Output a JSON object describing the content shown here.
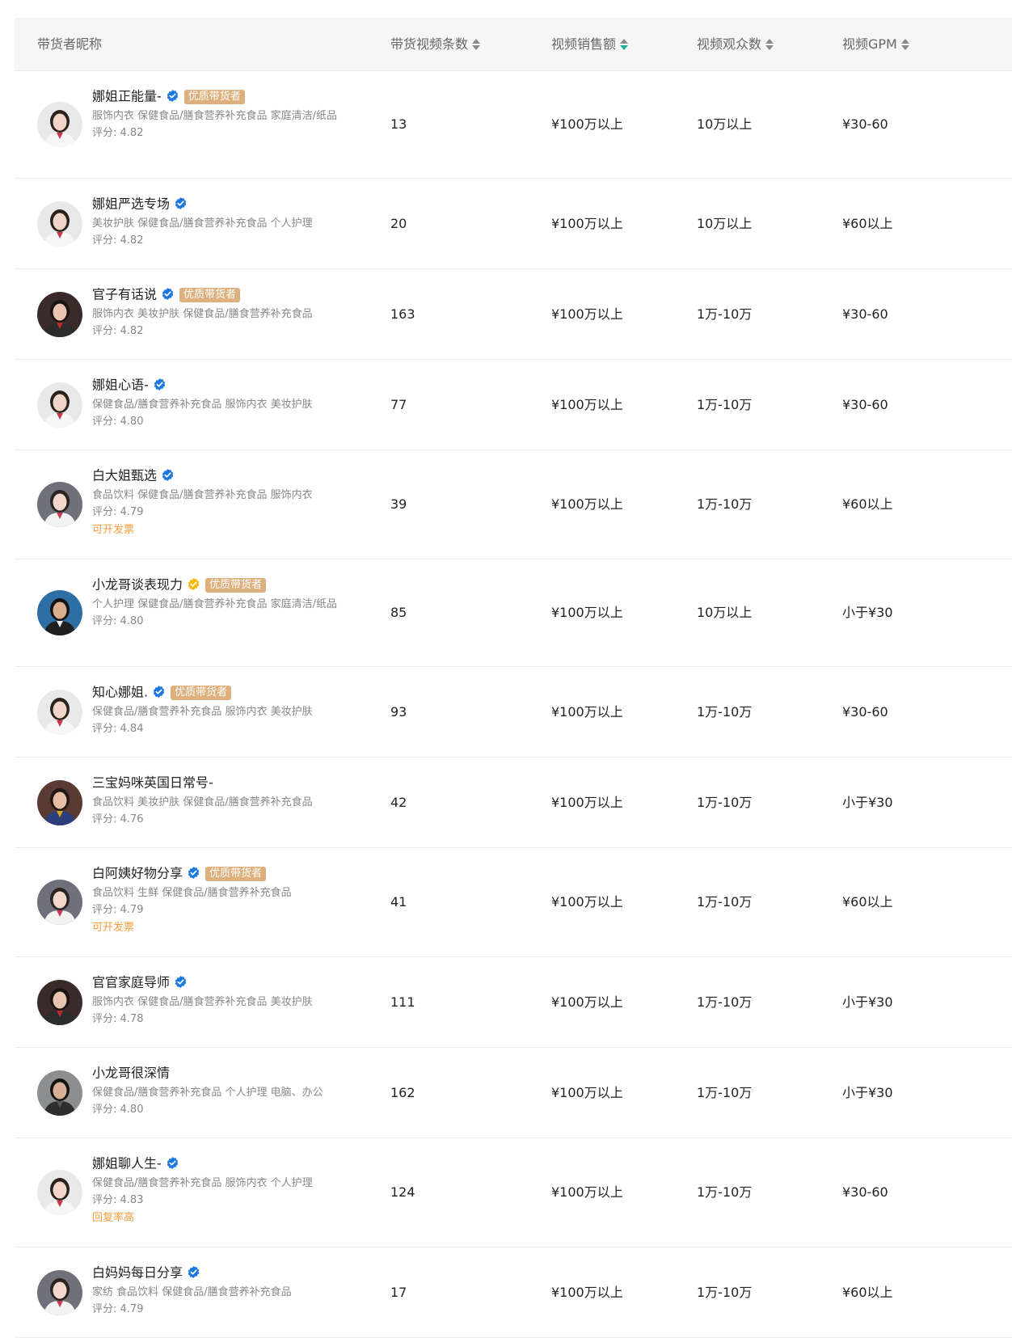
{
  "table": {
    "headers": {
      "name": "带货者昵称",
      "video_count": "带货视频条数",
      "video_sales": "视频销售额",
      "video_viewers": "视频观众数",
      "video_gpm": "视频GPM"
    },
    "active_sort": "video_sales",
    "score_prefix": "评分: ",
    "colors": {
      "badge_bg": "#ddb07e",
      "verified_blue": "#1b78e0",
      "verified_gold": "#f5b800",
      "sort_active": "#1ab394",
      "tag_orange": "#f59b3a"
    },
    "rows": [
      {
        "name": "娜姐正能量-",
        "verified": "blue",
        "badge": "优质带货者",
        "categories": "服饰内衣 保健食品/膳食营养补充食品 家庭清洁/纸品",
        "score": "4.82",
        "extra": "",
        "video_count": "13",
        "video_sales": "¥100万以上",
        "video_viewers": "10万以上",
        "video_gpm": "¥30-60",
        "avatar": "woman-white-suit"
      },
      {
        "name": "娜姐严选专场",
        "verified": "blue",
        "badge": "",
        "categories": "美妆护肤 保健食品/膳食营养补充食品 个人护理",
        "score": "4.82",
        "extra": "",
        "video_count": "20",
        "video_sales": "¥100万以上",
        "video_viewers": "10万以上",
        "video_gpm": "¥60以上",
        "avatar": "woman-white-suit"
      },
      {
        "name": "官子有话说",
        "verified": "blue",
        "badge": "优质带货者",
        "categories": "服饰内衣 美妆护肤 保健食品/膳食营养补充食品",
        "score": "4.82",
        "extra": "",
        "video_count": "163",
        "video_sales": "¥100万以上",
        "video_viewers": "1万-10万",
        "video_gpm": "¥30-60",
        "avatar": "man-dark"
      },
      {
        "name": "娜姐心语-",
        "verified": "blue",
        "badge": "",
        "categories": "保健食品/膳食营养补充食品 服饰内衣 美妆护肤",
        "score": "4.80",
        "extra": "",
        "video_count": "77",
        "video_sales": "¥100万以上",
        "video_viewers": "1万-10万",
        "video_gpm": "¥30-60",
        "avatar": "woman-white-suit"
      },
      {
        "name": "白大姐甄选",
        "verified": "blue",
        "badge": "",
        "categories": "食品饮料 保健食品/膳食营养补充食品 服饰内衣",
        "score": "4.79",
        "extra": "可开发票",
        "video_count": "39",
        "video_sales": "¥100万以上",
        "video_viewers": "1万-10万",
        "video_gpm": "¥60以上",
        "avatar": "woman-grey-bg"
      },
      {
        "name": "小龙哥谈表现力",
        "verified": "gold",
        "badge": "优质带货者",
        "categories": "个人护理 保健食品/膳食营养补充食品 家庭清洁/纸品",
        "score": "4.80",
        "extra": "",
        "video_count": "85",
        "video_sales": "¥100万以上",
        "video_viewers": "10万以上",
        "video_gpm": "小于¥30",
        "avatar": "man-blue-bg"
      },
      {
        "name": "知心娜姐.",
        "verified": "blue",
        "badge": "优质带货者",
        "categories": "保健食品/膳食营养补充食品 服饰内衣 美妆护肤",
        "score": "4.84",
        "extra": "",
        "video_count": "93",
        "video_sales": "¥100万以上",
        "video_viewers": "1万-10万",
        "video_gpm": "¥30-60",
        "avatar": "woman-white-suit"
      },
      {
        "name": "三宝妈咪英国日常号-",
        "verified": "",
        "badge": "",
        "categories": "食品饮料 美妆护肤 保健食品/膳食营养补充食品",
        "score": "4.76",
        "extra": "",
        "video_count": "42",
        "video_sales": "¥100万以上",
        "video_viewers": "1万-10万",
        "video_gpm": "小于¥30",
        "avatar": "family"
      },
      {
        "name": "白阿姨好物分享",
        "verified": "blue",
        "badge": "优质带货者",
        "categories": "食品饮料 生鲜 保健食品/膳食营养补充食品",
        "score": "4.79",
        "extra": "可开发票",
        "video_count": "41",
        "video_sales": "¥100万以上",
        "video_viewers": "1万-10万",
        "video_gpm": "¥60以上",
        "avatar": "woman-grey-bg"
      },
      {
        "name": "官官家庭导师",
        "verified": "blue",
        "badge": "",
        "categories": "服饰内衣 保健食品/膳食营养补充食品 美妆护肤",
        "score": "4.78",
        "extra": "",
        "video_count": "111",
        "video_sales": "¥100万以上",
        "video_viewers": "1万-10万",
        "video_gpm": "小于¥30",
        "avatar": "man-dark"
      },
      {
        "name": "小龙哥很深情",
        "verified": "",
        "badge": "",
        "categories": "保健食品/膳食营养补充食品 个人护理 电脑、办公",
        "score": "4.80",
        "extra": "",
        "video_count": "162",
        "video_sales": "¥100万以上",
        "video_viewers": "1万-10万",
        "video_gpm": "小于¥30",
        "avatar": "man-grey-bg"
      },
      {
        "name": "娜姐聊人生-",
        "verified": "blue",
        "badge": "",
        "categories": "保健食品/膳食营养补充食品 服饰内衣 个人护理",
        "score": "4.83",
        "extra": "回复率高",
        "video_count": "124",
        "video_sales": "¥100万以上",
        "video_viewers": "1万-10万",
        "video_gpm": "¥30-60",
        "avatar": "woman-white-suit"
      },
      {
        "name": "白妈妈每日分享",
        "verified": "blue",
        "badge": "",
        "categories": "家纺 食品饮料 保健食品/膳食营养补充食品",
        "score": "4.79",
        "extra": "",
        "video_count": "17",
        "video_sales": "¥100万以上",
        "video_viewers": "1万-10万",
        "video_gpm": "¥60以上",
        "avatar": "woman-grey-bg"
      }
    ]
  }
}
